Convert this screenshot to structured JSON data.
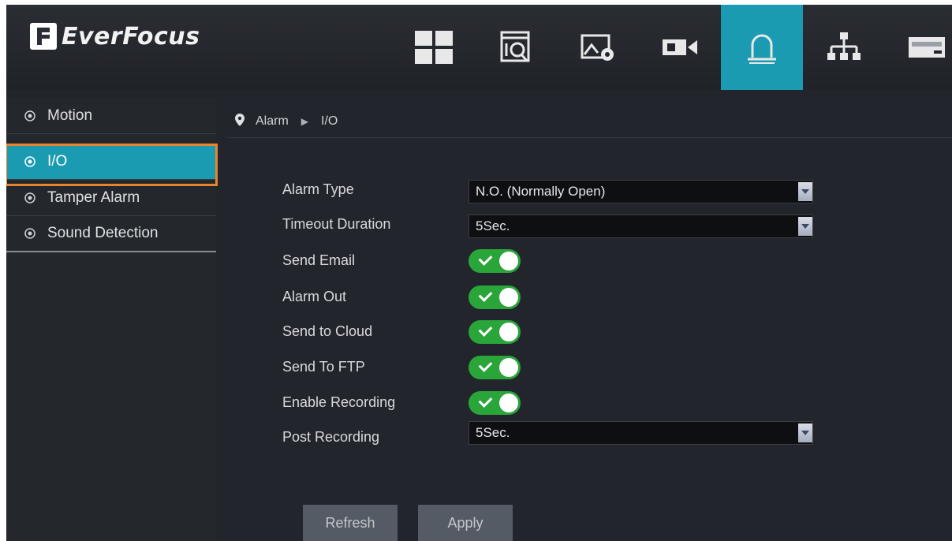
{
  "brand": {
    "name": "EverFocus"
  },
  "nav": [
    {
      "name": "live-view",
      "icon": "grid-icon"
    },
    {
      "name": "playback",
      "icon": "playback-icon"
    },
    {
      "name": "image-settings",
      "icon": "image-settings-icon"
    },
    {
      "name": "camera",
      "icon": "camera-icon"
    },
    {
      "name": "alarm",
      "icon": "alarm-bell-icon",
      "active": true
    },
    {
      "name": "network",
      "icon": "network-icon"
    },
    {
      "name": "device",
      "icon": "device-icon"
    }
  ],
  "sidebar": {
    "items": [
      {
        "label": "Motion",
        "icon": "gear-icon"
      },
      {
        "label": "I/O",
        "icon": "gear-icon",
        "active": true
      },
      {
        "label": "Tamper Alarm",
        "icon": "gear-icon"
      },
      {
        "label": "Sound Detection",
        "icon": "gear-icon"
      }
    ]
  },
  "breadcrumb": {
    "section": "Alarm",
    "page": "I/O"
  },
  "form": {
    "alarm_type": {
      "label": "Alarm Type",
      "value": "N.O. (Normally Open)"
    },
    "timeout_duration": {
      "label": "Timeout Duration",
      "value": "5Sec."
    },
    "send_email": {
      "label": "Send Email",
      "on": true
    },
    "alarm_out": {
      "label": "Alarm Out",
      "on": true
    },
    "send_to_cloud": {
      "label": "Send to Cloud",
      "on": true
    },
    "send_to_ftp": {
      "label": "Send To FTP",
      "on": true
    },
    "enable_recording": {
      "label": "Enable Recording",
      "on": true
    },
    "post_recording": {
      "label": "Post Recording",
      "value": "5Sec."
    }
  },
  "buttons": {
    "refresh": "Refresh",
    "apply": "Apply"
  },
  "colors": {
    "accent": "#1b9bb2",
    "highlight": "#e8842d",
    "toggle_on": "#2aa53a"
  }
}
